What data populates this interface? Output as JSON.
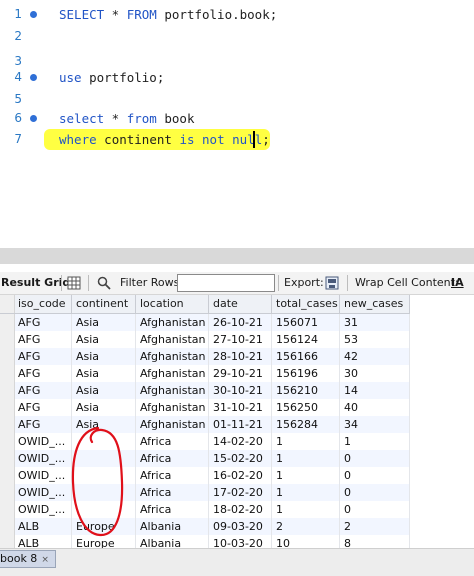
{
  "editor": {
    "lines": [
      {
        "num": "1",
        "dot": true,
        "parts": [
          {
            "t": "SELECT",
            "kw": true
          },
          {
            "t": " * "
          },
          {
            "t": "FROM",
            "kw": true
          },
          {
            "t": " portfolio.book;"
          }
        ]
      },
      {
        "num": "2",
        "dot": false,
        "parts": []
      },
      {
        "num": "3",
        "dot": false,
        "parts": []
      },
      {
        "num": "4",
        "dot": true,
        "parts": [
          {
            "t": "use",
            "kw": true
          },
          {
            "t": " portfolio;"
          }
        ]
      },
      {
        "num": "5",
        "dot": false,
        "parts": []
      },
      {
        "num": "6",
        "dot": true,
        "parts": [
          {
            "t": "select",
            "kw": true
          },
          {
            "t": " * "
          },
          {
            "t": "from",
            "kw": true
          },
          {
            "t": " book"
          }
        ]
      },
      {
        "num": "7",
        "dot": false,
        "parts": [
          {
            "t": "where",
            "kw": true
          },
          {
            "t": " continent "
          },
          {
            "t": "is not null",
            "kw": true
          },
          {
            "t": ";"
          }
        ]
      }
    ],
    "highlight_color": "#ffff38"
  },
  "toolbar": {
    "result_grid": "Result Grid",
    "filter_rows": "Filter Rows:",
    "filter_value": "",
    "export": "Export:",
    "wrap": "Wrap Cell Content:",
    "wrap_icon": "IA"
  },
  "grid": {
    "columns": [
      "iso_code",
      "continent",
      "location",
      "date",
      "total_cases",
      "new_cases"
    ],
    "rows": [
      [
        "AFG",
        "Asia",
        "Afghanistan",
        "26-10-21",
        "156071",
        "31"
      ],
      [
        "AFG",
        "Asia",
        "Afghanistan",
        "27-10-21",
        "156124",
        "53"
      ],
      [
        "AFG",
        "Asia",
        "Afghanistan",
        "28-10-21",
        "156166",
        "42"
      ],
      [
        "AFG",
        "Asia",
        "Afghanistan",
        "29-10-21",
        "156196",
        "30"
      ],
      [
        "AFG",
        "Asia",
        "Afghanistan",
        "30-10-21",
        "156210",
        "14"
      ],
      [
        "AFG",
        "Asia",
        "Afghanistan",
        "31-10-21",
        "156250",
        "40"
      ],
      [
        "AFG",
        "Asia",
        "Afghanistan",
        "01-11-21",
        "156284",
        "34"
      ],
      [
        "OWID_...",
        "",
        "Africa",
        "14-02-20",
        "1",
        "1"
      ],
      [
        "OWID_...",
        "",
        "Africa",
        "15-02-20",
        "1",
        "0"
      ],
      [
        "OWID_...",
        "",
        "Africa",
        "16-02-20",
        "1",
        "0"
      ],
      [
        "OWID_...",
        "",
        "Africa",
        "17-02-20",
        "1",
        "0"
      ],
      [
        "OWID_...",
        "",
        "Africa",
        "18-02-20",
        "1",
        "0"
      ],
      [
        "ALB",
        "Europe",
        "Albania",
        "09-03-20",
        "2",
        "2"
      ],
      [
        "ALB",
        "Europe",
        "Albania",
        "10-03-20",
        "10",
        "8"
      ]
    ]
  },
  "bottom": {
    "tab_label": "book 8",
    "close_glyph": "×"
  },
  "colors": {
    "keyword": "#2154c6",
    "line_number": "#2a78c4",
    "annotation": "#e0101a"
  }
}
